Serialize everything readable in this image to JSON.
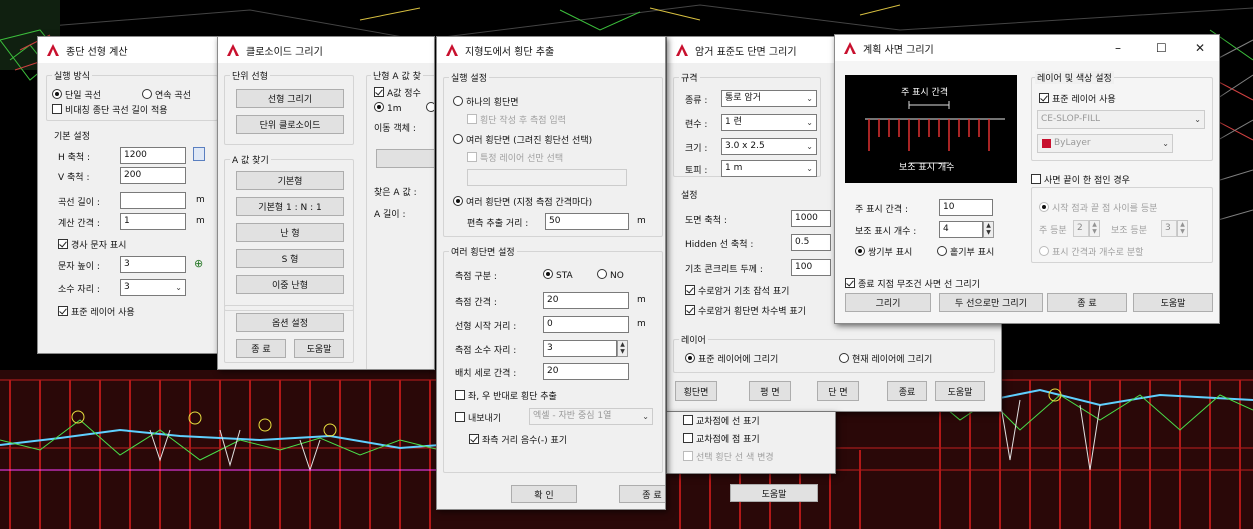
{
  "windows": {
    "w1": {
      "title": "종단 선형 계산",
      "exec_method": "실행 방식",
      "r_single": "단일 곡선",
      "r_cont": "연속 곡선",
      "cb_asym": "비대칭 종단 곡선 길이 적용",
      "basic": "기본 설정",
      "h_scale_label": "H 축척 :",
      "h_scale": "1200",
      "v_scale_label": "V 축척 :",
      "v_scale": "200",
      "curve_len_label": "곡선 길이 :",
      "curve_len": "",
      "calc_int_label": "계산 간격 :",
      "calc_int": "1",
      "unit_m": "m",
      "cb_slope": "경사 문자 표시",
      "text_h_label": "문자 높이 :",
      "text_h": "3",
      "dec_label": "소수 자리 :",
      "dec": "3",
      "cb_layer": "표준 레이어 사용"
    },
    "w2": {
      "title": "클로소이드 그리기",
      "unit_sel": "단위 선형",
      "b_draw": "선형 그리기",
      "b_unit": "단위 클로소이드",
      "a_find": "A 값 찾기",
      "b_basic": "기본형",
      "b_basic2": "기본형 1 : N : 1",
      "b_egg": "난 형",
      "b_s": "S 형",
      "b_double": "이중 난형",
      "b_opt": "옵션 설정",
      "b_end": "종 료",
      "b_help": "도움말",
      "cut_group": "난형 A 값 찾",
      "cb_a": "A값 정수",
      "r_1m": "1m",
      "move_label": "이동 객체 :",
      "found_a": "찾은 A 값 :",
      "a_len": "A 길이 :"
    },
    "w3": {
      "title": "지형도에서 횡단 추출",
      "exec": "실행 설정",
      "r_one": "하나의 횡단면",
      "cb_draw_cross": "횡단 작성 후 측점 입력",
      "r_multi": "여러 횡단면 (그려진 횡단선 선택)",
      "cb_layer_only": "특정 레이어 선만 선택",
      "r_multi2": "여러 횡단면 (지정 측점 간격마다)",
      "offset_label": "편측 추출 거리 :",
      "offset": "50",
      "unit_m": "m",
      "multi_set": "여러 횡단면 설정",
      "sta_type_label": "측점 구분 :",
      "r_sta": "STA",
      "r_no": "NO",
      "sta_int_label": "측점 간격 :",
      "sta_int": "20",
      "start_dist_label": "선형 시작 거리 :",
      "start_dist": "0",
      "dec_label": "측점 소수 자리 :",
      "dec": "3",
      "vert_int_label": "배치 세로 간격 :",
      "vert_int": "20",
      "cb_reverse": "좌, 우 반대로 횡단 추출",
      "cb_export": "내보내기",
      "export_sel": "엑셀 - 자반 중심 1열",
      "cb_left_neg": "좌측 거리 음수(-) 표기",
      "b_ok": "확 인",
      "b_end": "종 료",
      "b_help": "도움말"
    },
    "w4": {
      "title": "암거 표준도 단면 그리기",
      "spec": "규격",
      "type_label": "종류 :",
      "type": "통로 암거",
      "count_label": "련수 :",
      "count": "1 련",
      "size_label": "크기 :",
      "size": "3.0 x 2.5",
      "fill_label": "토피 :",
      "fill": "1 m",
      "settings": "설정",
      "scale_label": "도면 축척 :",
      "scale": "1000",
      "hidden_label": "Hidden 선 축척 :",
      "hidden": "0.5",
      "conc_label": "기초 콘크리트 두께 :",
      "conc": "100",
      "cb_footing": "수로암거 기초 잡석 표기",
      "cb_wall": "수로암거 횡단면 차수벽 표기",
      "layer": "레이어",
      "r_std_layer": "표준 레이어에 그리기",
      "r_cur_layer": "현재 레이어에 그리기",
      "b_cross": "횡단면",
      "b_plan": "평 면",
      "b_section": "단 면",
      "b_end": "종료",
      "b_help": "도움말",
      "cb_inter1": "교차점에 선 표기",
      "cb_inter2": "교차점에 점 표기",
      "cb_color": "선택 횡단 선 색 변경"
    },
    "w5": {
      "title": "계획 사면 그리기",
      "preview_top": "주 표시 간격",
      "preview_bottom": "보조 표시 개수",
      "main_int_label": "주 표시 간격 :",
      "main_int": "10",
      "sub_cnt_label": "보조 표시 개수 :",
      "sub_cnt": "4",
      "r_double": "쌍기부 표시",
      "r_single": "홑기부 표시",
      "cb_end_slope": "종료 지점 무조건 사면 선 그리기",
      "layer_group": "레이어 및 색상 설정",
      "cb_std_layer": "표준 레이어 사용",
      "layer_name": "CE-SLOP-FILL",
      "color_name": "ByLayer",
      "cb_edge": "사면 끝이 한 점인 경우",
      "r_eq": "시작 점과 끝 점 사이를 등분",
      "main_eq_label": "주 등분",
      "main_eq": "2",
      "sub_eq_label": "보조 등분",
      "sub_eq": "3",
      "r_show": "표시 간격과 개수로 분할",
      "b_draw": "그리기",
      "b_two": "두 선으로만 그리기",
      "b_end": "종 료",
      "b_help": "도움말",
      "win_min": "–",
      "win_max": "☐",
      "win_close": "✕"
    }
  },
  "colors": {
    "accent_red": "#c8102e",
    "cad_bg": "#000000"
  }
}
